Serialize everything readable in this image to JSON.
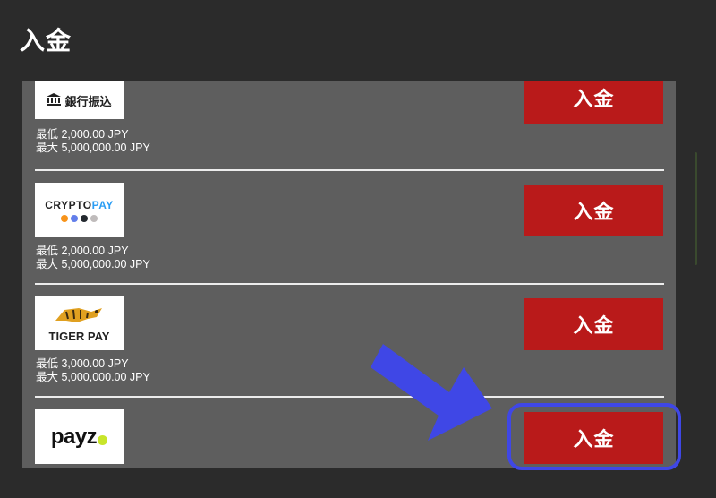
{
  "header": {
    "title": "入金"
  },
  "colors": {
    "background": "#2b2b2b",
    "panel": "#5e5e5e",
    "button": "#b91a1a",
    "highlight": "#3f47e6"
  },
  "methods": [
    {
      "logo_text": "銀行振込",
      "logo_icon": "bank-icon",
      "min": "最低 2,000.00 JPY",
      "max": "最大 5,000,000.00 JPY",
      "button": "入金"
    },
    {
      "logo_text_a": "CRYPTO",
      "logo_text_b": "PAY",
      "min": "最低 2,000.00 JPY",
      "max": "最大 5,000,000.00 JPY",
      "button": "入金"
    },
    {
      "logo_text": "TIGER PAY",
      "logo_icon": "tiger-icon",
      "min": "最低 3,000.00 JPY",
      "max": "最大 5,000,000.00 JPY",
      "button": "入金"
    },
    {
      "logo_text": "payz",
      "button": "入金"
    }
  ]
}
